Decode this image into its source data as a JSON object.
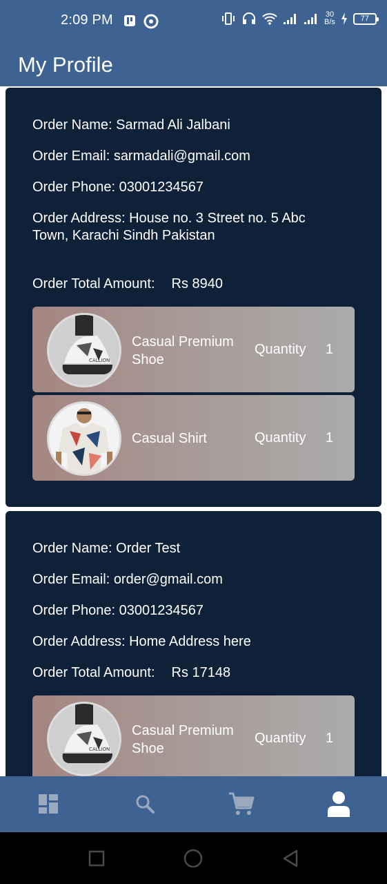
{
  "status": {
    "time": "2:09 PM",
    "net_speed_value": "30",
    "net_speed_unit": "B/s",
    "battery": "77"
  },
  "app": {
    "title": "My Profile"
  },
  "labels": {
    "name": "Order Name:",
    "email": "Order Email:",
    "phone": "Order Phone:",
    "address": "Order Address:",
    "total": "Order Total Amount:",
    "quantity": "Quantity"
  },
  "orders": [
    {
      "name": "Sarmad Ali Jalbani",
      "email": "sarmadali@gmail.com",
      "phone": "03001234567",
      "address": "House no. 3 Street no. 5 Abc Town, Karachi Sindh Pakistan",
      "total": "Rs 8940",
      "items": [
        {
          "name": "Casual Premium Shoe",
          "qty": "1",
          "image": "shoe-image"
        },
        {
          "name": "Casual Shirt",
          "qty": "1",
          "image": "shirt-image"
        }
      ]
    },
    {
      "name": "Order Test",
      "email": "order@gmail.com",
      "phone": "03001234567",
      "address": "Home Address here",
      "total": "Rs 17148",
      "items": [
        {
          "name": "Casual Premium Shoe",
          "qty": "1",
          "image": "shoe-image"
        }
      ]
    }
  ],
  "nav": [
    {
      "icon": "dashboard-icon",
      "active": false
    },
    {
      "icon": "search-icon",
      "active": false
    },
    {
      "icon": "cart-icon",
      "active": false
    },
    {
      "icon": "profile-icon",
      "active": true
    }
  ],
  "colors": {
    "primary": "#3e6392",
    "card": "#0f2039",
    "nav_inactive": "#9aa9bd",
    "nav_active": "#ffffff"
  }
}
